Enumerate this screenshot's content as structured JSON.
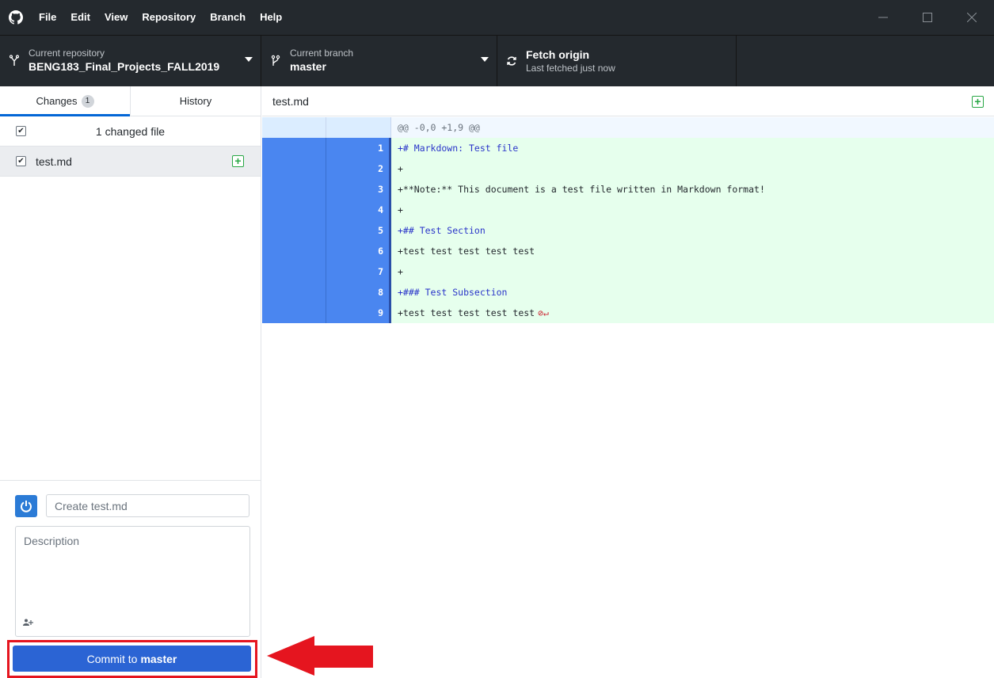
{
  "menu": {
    "items": [
      "File",
      "Edit",
      "View",
      "Repository",
      "Branch",
      "Help"
    ]
  },
  "toolbar": {
    "repo_label": "Current repository",
    "repo_value": "BENG183_Final_Projects_FALL2019",
    "branch_label": "Current branch",
    "branch_value": "master",
    "fetch_title": "Fetch origin",
    "fetch_sub": "Last fetched just now"
  },
  "tabs": {
    "changes": "Changes",
    "changes_count": "1",
    "history": "History"
  },
  "files": {
    "header": "1 changed file",
    "items": [
      {
        "name": "test.md",
        "status": "added"
      }
    ]
  },
  "commit": {
    "summary_placeholder": "Create test.md",
    "description_placeholder": "Description",
    "button_prefix": "Commit to",
    "button_branch": "master"
  },
  "diff": {
    "filename": "test.md",
    "hunk": "@@ -0,0 +1,9 @@",
    "lines": [
      {
        "n": "1",
        "text": "+# Markdown: Test file",
        "style": "blue"
      },
      {
        "n": "2",
        "text": "+",
        "style": "plain"
      },
      {
        "n": "3",
        "text": "+**Note:** This document is a test file written in Markdown format!",
        "style": "plain"
      },
      {
        "n": "4",
        "text": "+",
        "style": "plain"
      },
      {
        "n": "5",
        "text": "+## Test Section",
        "style": "blue"
      },
      {
        "n": "6",
        "text": "+test test test test test",
        "style": "plain"
      },
      {
        "n": "7",
        "text": "+",
        "style": "plain"
      },
      {
        "n": "8",
        "text": "+### Test Subsection",
        "style": "blue"
      },
      {
        "n": "9",
        "text": "+test test test test test",
        "style": "plain",
        "no_newline": true
      }
    ]
  },
  "colors": {
    "titlebar": "#24292e",
    "accent": "#0366d6",
    "added_bg": "#e6ffed",
    "gutter_selected": "#4a86f0",
    "commit_button": "#2b64d4",
    "highlight_red": "#e5151f"
  }
}
